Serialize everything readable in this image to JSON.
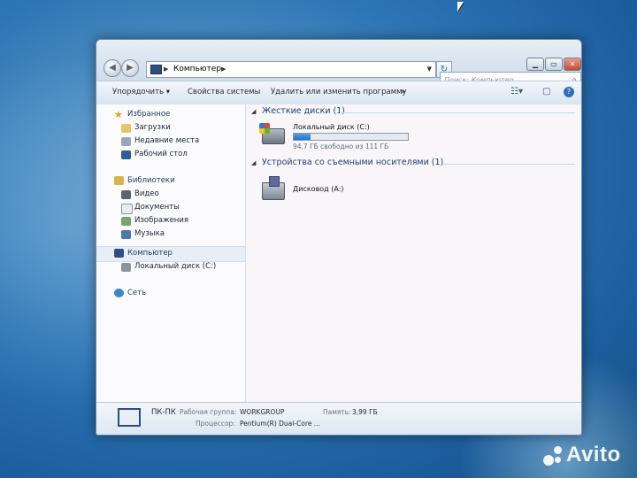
{
  "window": {
    "address": {
      "crumb": "Компьютер"
    },
    "search_placeholder": "Поиск: Компьютер",
    "controls": {
      "minimize": "▁",
      "maximize": "▭",
      "close": "✕"
    }
  },
  "toolbar": {
    "organize": "Упорядочить",
    "system_props": "Свойства системы",
    "uninstall": "Удалить или изменить программу",
    "more": "»"
  },
  "nav": {
    "favorites": "Избранное",
    "downloads": "Загрузки",
    "recent": "Недавние места",
    "desktop": "Рабочий стол",
    "libraries": "Библиотеки",
    "video": "Видео",
    "documents": "Документы",
    "images": "Изображения",
    "music": "Музыка",
    "computer": "Компьютер",
    "local_disk": "Локальный диск (C:)",
    "network": "Сеть"
  },
  "content": {
    "hdd_group": "Жесткие диски (1)",
    "local_disk_label": "Локальный диск (C:)",
    "local_disk_free": "94,7 ГБ свободно из 111 ГБ",
    "local_disk_used_fraction": 0.15,
    "removable_group": "Устройства со съемными носителями (1)",
    "floppy_label": "Дисковод (A:)"
  },
  "details": {
    "pc_name": "ПК-ПК",
    "workgroup_label": "Рабочая группа:",
    "workgroup_value": "WORKGROUP",
    "memory_label": "Память:",
    "memory_value": "3,99 ГБ",
    "cpu_label": "Процессор:",
    "cpu_value": "Pentium(R) Dual-Core ..."
  },
  "watermark": {
    "brand": "Avito"
  }
}
